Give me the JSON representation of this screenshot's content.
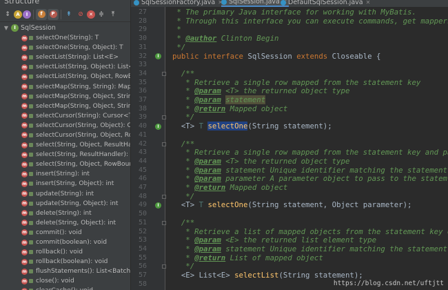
{
  "structure": {
    "title": "Structure",
    "root": {
      "label": "SqlSession",
      "icon": "interface-icon"
    },
    "members": [
      "selectOne(String): T",
      "selectOne(String, Object): T",
      "selectList(String): List<E>",
      "selectList(String, Object): List<E>",
      "selectList(String, Object, RowBounds",
      "selectMap(String, String): Map<K, V",
      "selectMap(String, Object, String): M",
      "selectMap(String, Object, String, Ro",
      "selectCursor(String): Cursor<T>",
      "selectCursor(String, Object): Cursor",
      "selectCursor(String, Object, RowBo",
      "select(String, Object, ResultHandle",
      "select(String, ResultHandler): void",
      "select(String, Object, RowBounds, R",
      "insert(String): int",
      "insert(String, Object): int",
      "update(String): int",
      "update(String, Object): int",
      "delete(String): int",
      "delete(String, Object): int",
      "commit(): void",
      "commit(boolean): void",
      "rollback(): void",
      "rollback(boolean): void",
      "flushStatements(): List<BatchResult",
      "close(): void",
      "clearCache(): void"
    ]
  },
  "tabs": [
    {
      "label": "SqlSessionFactory.java",
      "selected": false
    },
    {
      "label": "SqlSession.java",
      "selected": true
    },
    {
      "label": "DefaultSqlSession.java",
      "selected": false
    }
  ],
  "editor": {
    "lines": [
      {
        "n": "27",
        "t": " * The primary Java interface for working with MyBatis."
      },
      {
        "n": "28",
        "t": " * Through this interface you can execute commands, get mappers"
      },
      {
        "n": "29",
        "t": " *"
      },
      {
        "n": "30",
        "t": " * @author Clinton Begin"
      },
      {
        "n": "31",
        "t": " */"
      },
      {
        "n": "32",
        "t": "public interface SqlSession extends Closeable {"
      },
      {
        "n": "33",
        "t": ""
      },
      {
        "n": "34",
        "t": "  /**"
      },
      {
        "n": "35",
        "t": "   * Retrieve a single row mapped from the statement key"
      },
      {
        "n": "36",
        "t": "   * @param <T> the returned object type"
      },
      {
        "n": "37",
        "t": "   * @param statement"
      },
      {
        "n": "38",
        "t": "   * @return Mapped object"
      },
      {
        "n": "39",
        "t": "   */"
      },
      {
        "n": "40",
        "t": "  <T> T selectOne(String statement);"
      },
      {
        "n": "41",
        "t": ""
      },
      {
        "n": "42",
        "t": "  /**"
      },
      {
        "n": "43",
        "t": "   * Retrieve a single row mapped from the statement key and pa"
      },
      {
        "n": "44",
        "t": "   * @param <T> the returned object type"
      },
      {
        "n": "45",
        "t": "   * @param statement Unique identifier matching the statement"
      },
      {
        "n": "46",
        "t": "   * @param parameter A parameter object to pass to the statem"
      },
      {
        "n": "47",
        "t": "   * @return Mapped object"
      },
      {
        "n": "48",
        "t": "   */"
      },
      {
        "n": "49",
        "t": "  <T> T selectOne(String statement, Object parameter);"
      },
      {
        "n": "50",
        "t": ""
      },
      {
        "n": "51",
        "t": "  /**"
      },
      {
        "n": "52",
        "t": "   * Retrieve a list of mapped objects from the statement key o"
      },
      {
        "n": "53",
        "t": "   * @param <E> the returned list element type"
      },
      {
        "n": "54",
        "t": "   * @param statement Unique identifier matching the statement"
      },
      {
        "n": "55",
        "t": "   * @return List of mapped object"
      },
      {
        "n": "56",
        "t": "   */"
      },
      {
        "n": "57",
        "t": "  <E> List<E> selectList(String statement);"
      },
      {
        "n": "58",
        "t": ""
      }
    ]
  },
  "watermark": "https://blog.csdn.net/uftjtt",
  "colors": {
    "comment": "#629755",
    "keyword": "#cc7832",
    "method": "#ffc66d",
    "selection": "#214283"
  }
}
